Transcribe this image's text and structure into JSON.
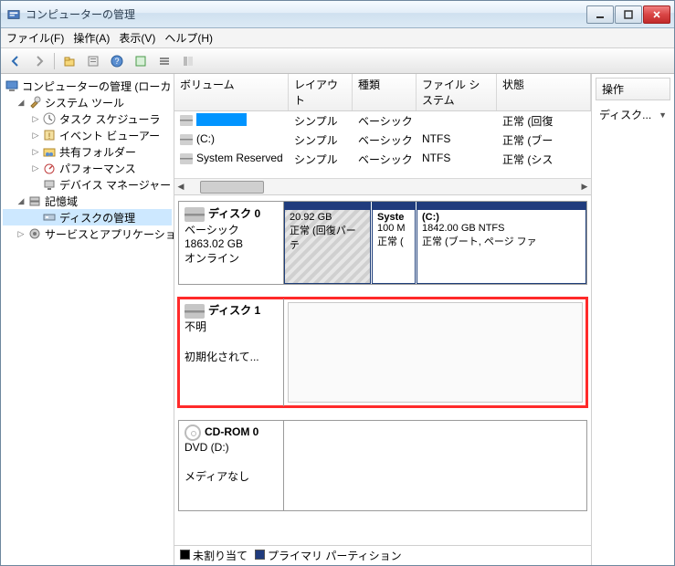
{
  "window": {
    "title": "コンピューターの管理"
  },
  "menu": {
    "file": "ファイル(F)",
    "action": "操作(A)",
    "view": "表示(V)",
    "help": "ヘルプ(H)"
  },
  "tree": {
    "root": "コンピューターの管理 (ローカ",
    "systemTools": "システム ツール",
    "taskScheduler": "タスク スケジューラ",
    "eventViewer": "イベント ビューアー",
    "sharedFolders": "共有フォルダー",
    "performance": "パフォーマンス",
    "deviceManager": "デバイス マネージャー",
    "storage": "記憶域",
    "diskManagement": "ディスクの管理",
    "services": "サービスとアプリケーショ"
  },
  "volHeaders": {
    "volume": "ボリューム",
    "layout": "レイアウト",
    "type": "種類",
    "fs": "ファイル システム",
    "status": "状態"
  },
  "volumes": [
    {
      "name": "",
      "layout": "シンプル",
      "type": "ベーシック",
      "fs": "",
      "status": "正常 (回復"
    },
    {
      "name": "(C:)",
      "layout": "シンプル",
      "type": "ベーシック",
      "fs": "NTFS",
      "status": "正常 (ブー"
    },
    {
      "name": "System Reserved",
      "layout": "シンプル",
      "type": "ベーシック",
      "fs": "NTFS",
      "status": "正常 (シス"
    }
  ],
  "disks": {
    "d0": {
      "title": "ディスク 0",
      "kind": "ベーシック",
      "size": "1863.02 GB",
      "state": "オンライン",
      "parts": [
        {
          "name": "",
          "size": "20.92 GB",
          "status": "正常 (回復パーテ"
        },
        {
          "name": "Syste",
          "size": "100 M",
          "status": "正常 ("
        },
        {
          "name": "(C:)",
          "size": "1842.00 GB NTFS",
          "status": "正常 (ブート, ページ ファ"
        }
      ]
    },
    "d1": {
      "title": "ディスク 1",
      "kind": "不明",
      "state": "初期化されて..."
    },
    "cd": {
      "title": "CD-ROM 0",
      "kind": "DVD (D:)",
      "state": "メディアなし"
    }
  },
  "legend": {
    "unallocated": "未割り当て",
    "primary": "プライマリ パーティション"
  },
  "actions": {
    "header": "操作",
    "item": "ディスク..."
  }
}
